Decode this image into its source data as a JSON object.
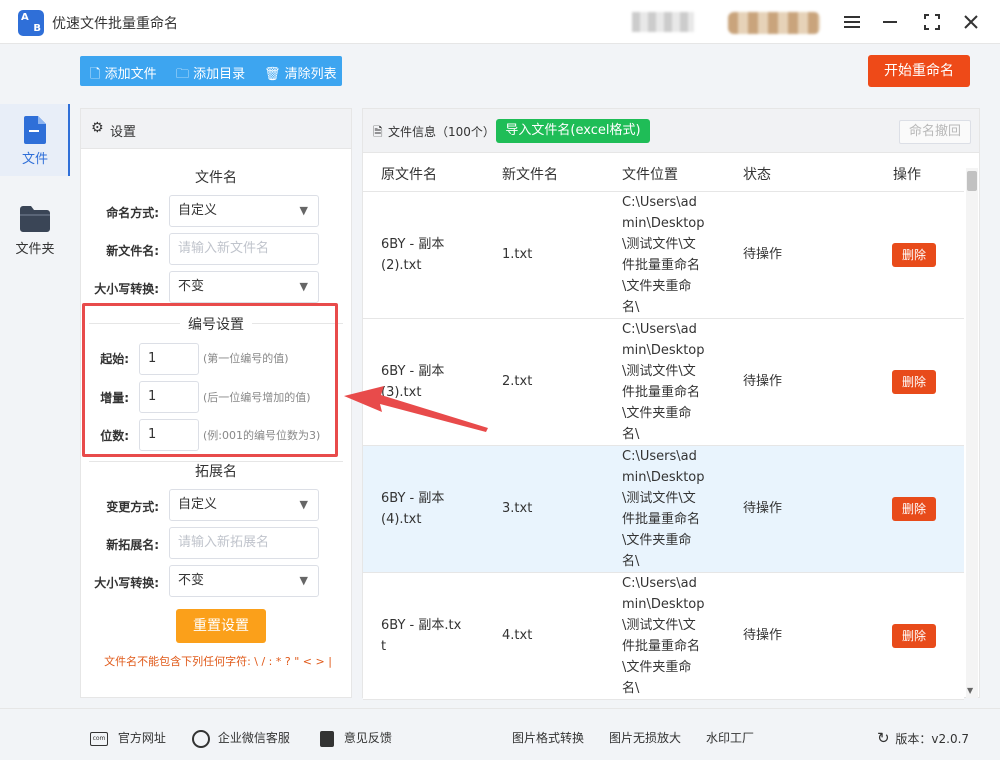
{
  "app": {
    "title": "优速文件批量重命名",
    "logo_text": "AB"
  },
  "header": {
    "start_button": "开始重命名"
  },
  "toolbar": {
    "add_file": "添加文件",
    "add_dir": "添加目录",
    "clear_list": "清除列表"
  },
  "rail": {
    "items": [
      {
        "label": "文件",
        "icon": "file-icon"
      },
      {
        "label": "文件夹",
        "icon": "folder-icon"
      }
    ]
  },
  "settings": {
    "title": "设置",
    "filename": {
      "section": "文件名",
      "mode_label": "命名方式:",
      "mode_value": "自定义",
      "newname_label": "新文件名:",
      "newname_placeholder": "请输入新文件名",
      "case_label": "大小写转换:",
      "case_value": "不变"
    },
    "numbering": {
      "section": "编号设置",
      "start_label": "起始:",
      "start_value": "1",
      "start_hint": "(第一位编号的值)",
      "step_label": "增量:",
      "step_value": "1",
      "step_hint": "(后一位编号增加的值)",
      "digits_label": "位数:",
      "digits_value": "1",
      "digits_hint": "(例:001的编号位数为3)"
    },
    "extension": {
      "section": "拓展名",
      "mode_label": "变更方式:",
      "mode_value": "自定义",
      "newext_label": "新拓展名:",
      "newext_placeholder": "请输入新拓展名",
      "case_label": "大小写转换:",
      "case_value": "不变"
    },
    "reset_button": "重置设置",
    "warning": "文件名不能包含下列任何字符: \\ / : * ? \" < > |"
  },
  "files": {
    "info": "文件信息（100个）",
    "import_button": "导入文件名(excel格式)",
    "undo_button": "命名撤回",
    "columns": [
      "原文件名",
      "新文件名",
      "文件位置",
      "状态",
      "操作"
    ],
    "rows": [
      {
        "orig": [
          "6BY - 副本",
          "(2).txt"
        ],
        "new": "1.txt",
        "path": [
          "C:\\Users\\ad",
          "min\\Desktop",
          "\\测试文件\\文",
          "件批量重命名",
          "\\文件夹重命",
          "名\\"
        ],
        "status": "待操作",
        "action": "删除"
      },
      {
        "orig": [
          "6BY - 副本",
          "(3).txt"
        ],
        "new": "2.txt",
        "path": [
          "C:\\Users\\ad",
          "min\\Desktop",
          "\\测试文件\\文",
          "件批量重命名",
          "\\文件夹重命",
          "名\\"
        ],
        "status": "待操作",
        "action": "删除"
      },
      {
        "orig": [
          "6BY - 副本",
          "(4).txt"
        ],
        "new": "3.txt",
        "path": [
          "C:\\Users\\ad",
          "min\\Desktop",
          "\\测试文件\\文",
          "件批量重命名",
          "\\文件夹重命",
          "名\\"
        ],
        "status": "待操作",
        "action": "删除"
      },
      {
        "orig": [
          "6BY - 副本.tx",
          "t"
        ],
        "new": "4.txt",
        "path": [
          "C:\\Users\\ad",
          "min\\Desktop",
          "\\测试文件\\文",
          "件批量重命名",
          "\\文件夹重命",
          "名\\"
        ],
        "status": "待操作",
        "action": "删除"
      }
    ]
  },
  "footer": {
    "website": "官方网址",
    "wechat": "企业微信客服",
    "feedback": "意见反馈",
    "img_convert": "图片格式转换",
    "img_enlarge": "图片无损放大",
    "watermark": "水印工厂",
    "version": "版本：v2.0.7"
  },
  "colors": {
    "accent": "#3da5f0",
    "start": "#ee4a18",
    "import": "#1fbd57",
    "highlight": "#e84b4b",
    "reset": "#fba01a"
  }
}
